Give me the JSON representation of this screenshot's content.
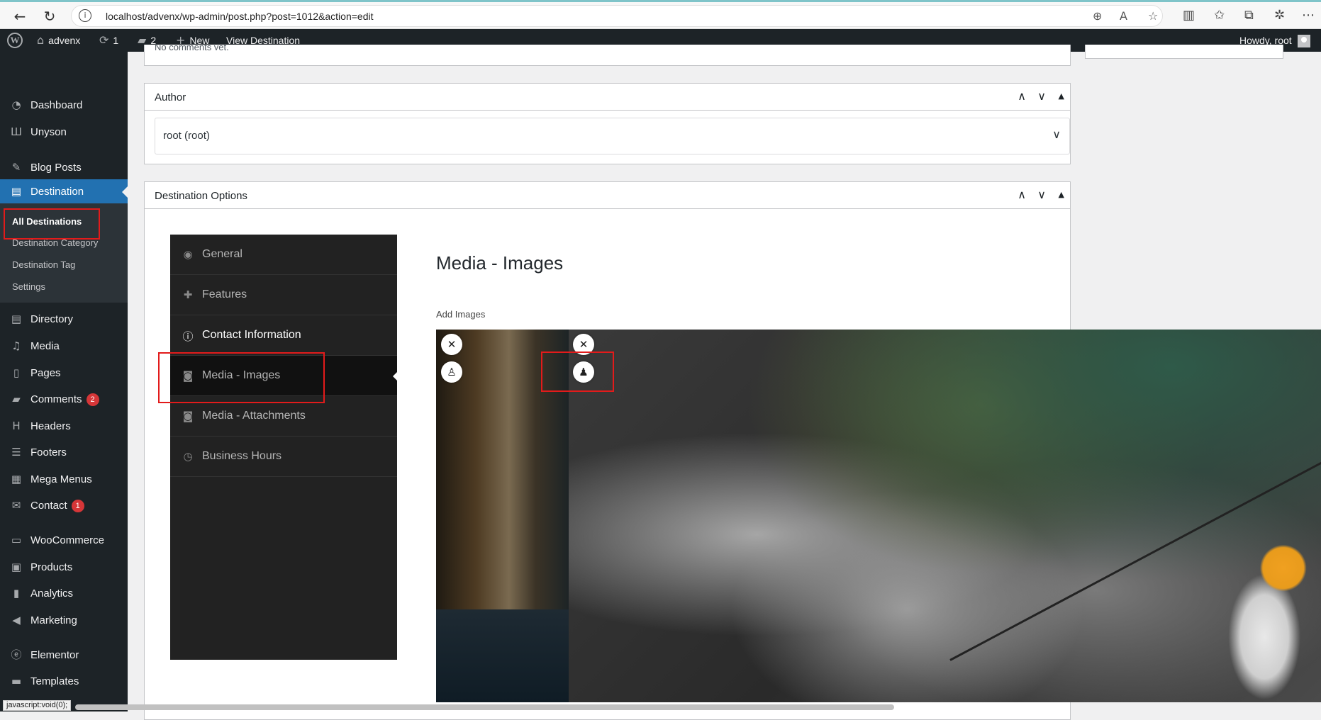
{
  "browser": {
    "url": "localhost/advenx/wp-admin/post.php?post=1012&action=edit",
    "back_icon": "arrow-left-icon",
    "refresh_icon": "refresh-icon"
  },
  "adminbar": {
    "site_name": "advenx",
    "updates_count": "1",
    "comments_count": "2",
    "new_label": "New",
    "view_label": "View Destination",
    "howdy": "Howdy, root"
  },
  "sidebar": {
    "items": [
      {
        "label": "Dashboard",
        "icon": "dashboard-icon"
      },
      {
        "label": "Unyson",
        "icon": "unyson-icon"
      },
      {
        "label": "Blog Posts",
        "icon": "pin-icon"
      },
      {
        "label": "Destination",
        "icon": "destination-icon"
      },
      {
        "label": "Directory",
        "icon": "directory-icon"
      },
      {
        "label": "Media",
        "icon": "media-icon"
      },
      {
        "label": "Pages",
        "icon": "pages-icon"
      },
      {
        "label": "Comments",
        "icon": "comments-icon",
        "badge": "2"
      },
      {
        "label": "Headers",
        "icon": "headers-icon"
      },
      {
        "label": "Footers",
        "icon": "footers-icon"
      },
      {
        "label": "Mega Menus",
        "icon": "mega-menus-icon"
      },
      {
        "label": "Contact",
        "icon": "contact-icon",
        "badge": "1"
      },
      {
        "label": "WooCommerce",
        "icon": "woocommerce-icon"
      },
      {
        "label": "Products",
        "icon": "products-icon"
      },
      {
        "label": "Analytics",
        "icon": "analytics-icon"
      },
      {
        "label": "Marketing",
        "icon": "marketing-icon"
      },
      {
        "label": "Elementor",
        "icon": "elementor-icon"
      },
      {
        "label": "Templates",
        "icon": "templates-icon"
      }
    ],
    "submenu": [
      "All Destinations",
      "Destination Category",
      "Destination Tag",
      "Settings"
    ]
  },
  "content": {
    "partial_text": "No comments yet.",
    "author_box": {
      "title": "Author",
      "selected": "root (root)"
    },
    "options_box": {
      "title": "Destination Options"
    },
    "tabs": [
      "General",
      "Features",
      "Contact Information",
      "Media - Images",
      "Media - Attachments",
      "Business Hours"
    ],
    "section_title": "Media - Images",
    "add_images_label": "Add Images"
  },
  "status_text": "javascript:void(0);",
  "colors": {
    "admin_bar": "#1d2327",
    "active_menu": "#2271b1",
    "badge": "#d63638",
    "highlight": "#e21b1b",
    "tab_panel": "#222222"
  }
}
